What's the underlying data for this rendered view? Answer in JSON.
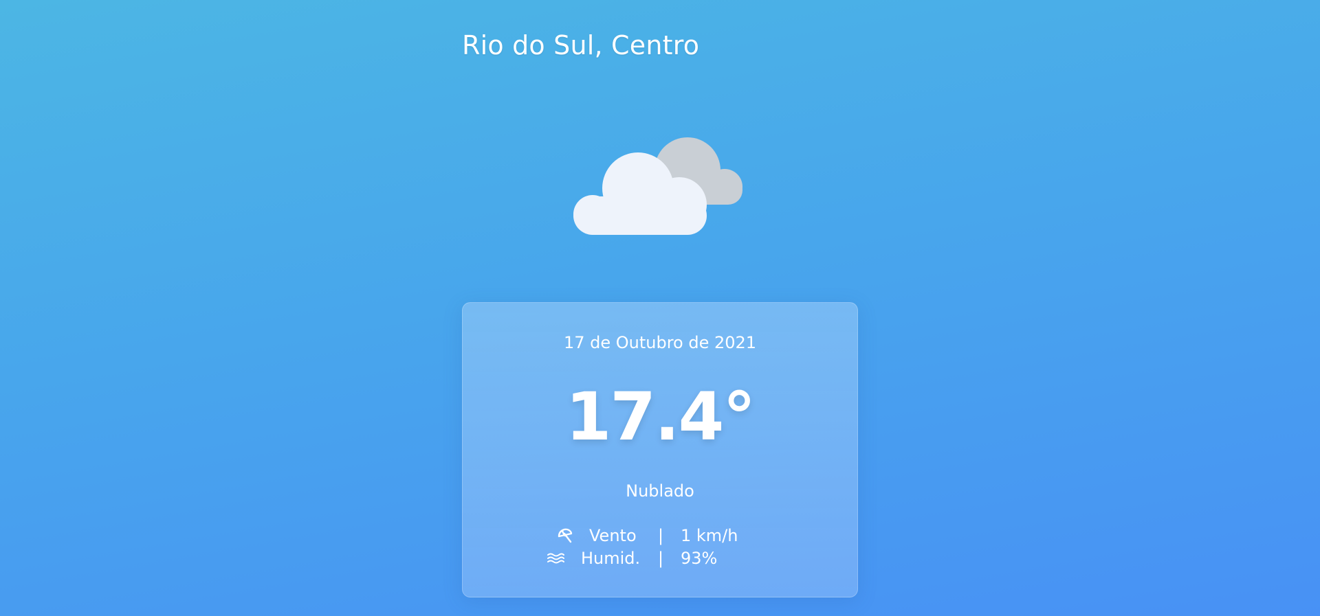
{
  "location": {
    "title": "Rio do Sul, Centro"
  },
  "current": {
    "icon": "cloudy-icon",
    "date": "17 de Outubro de 2021",
    "temperature": "17.4°",
    "condition": "Nublado",
    "details": {
      "wind": {
        "icon": "umbrella-icon",
        "label": "Vento",
        "separator": "|",
        "value": "1 km/h"
      },
      "humidity": {
        "icon": "humidity-waves-icon",
        "label": "Humid.",
        "separator": "|",
        "value": "93%"
      }
    }
  },
  "colors": {
    "background_top": "#4cb6e4",
    "background_bottom": "#4891f5",
    "cloud_front": "#eef3fb",
    "cloud_back": "#c9cfd5",
    "text": "#ffffff"
  }
}
